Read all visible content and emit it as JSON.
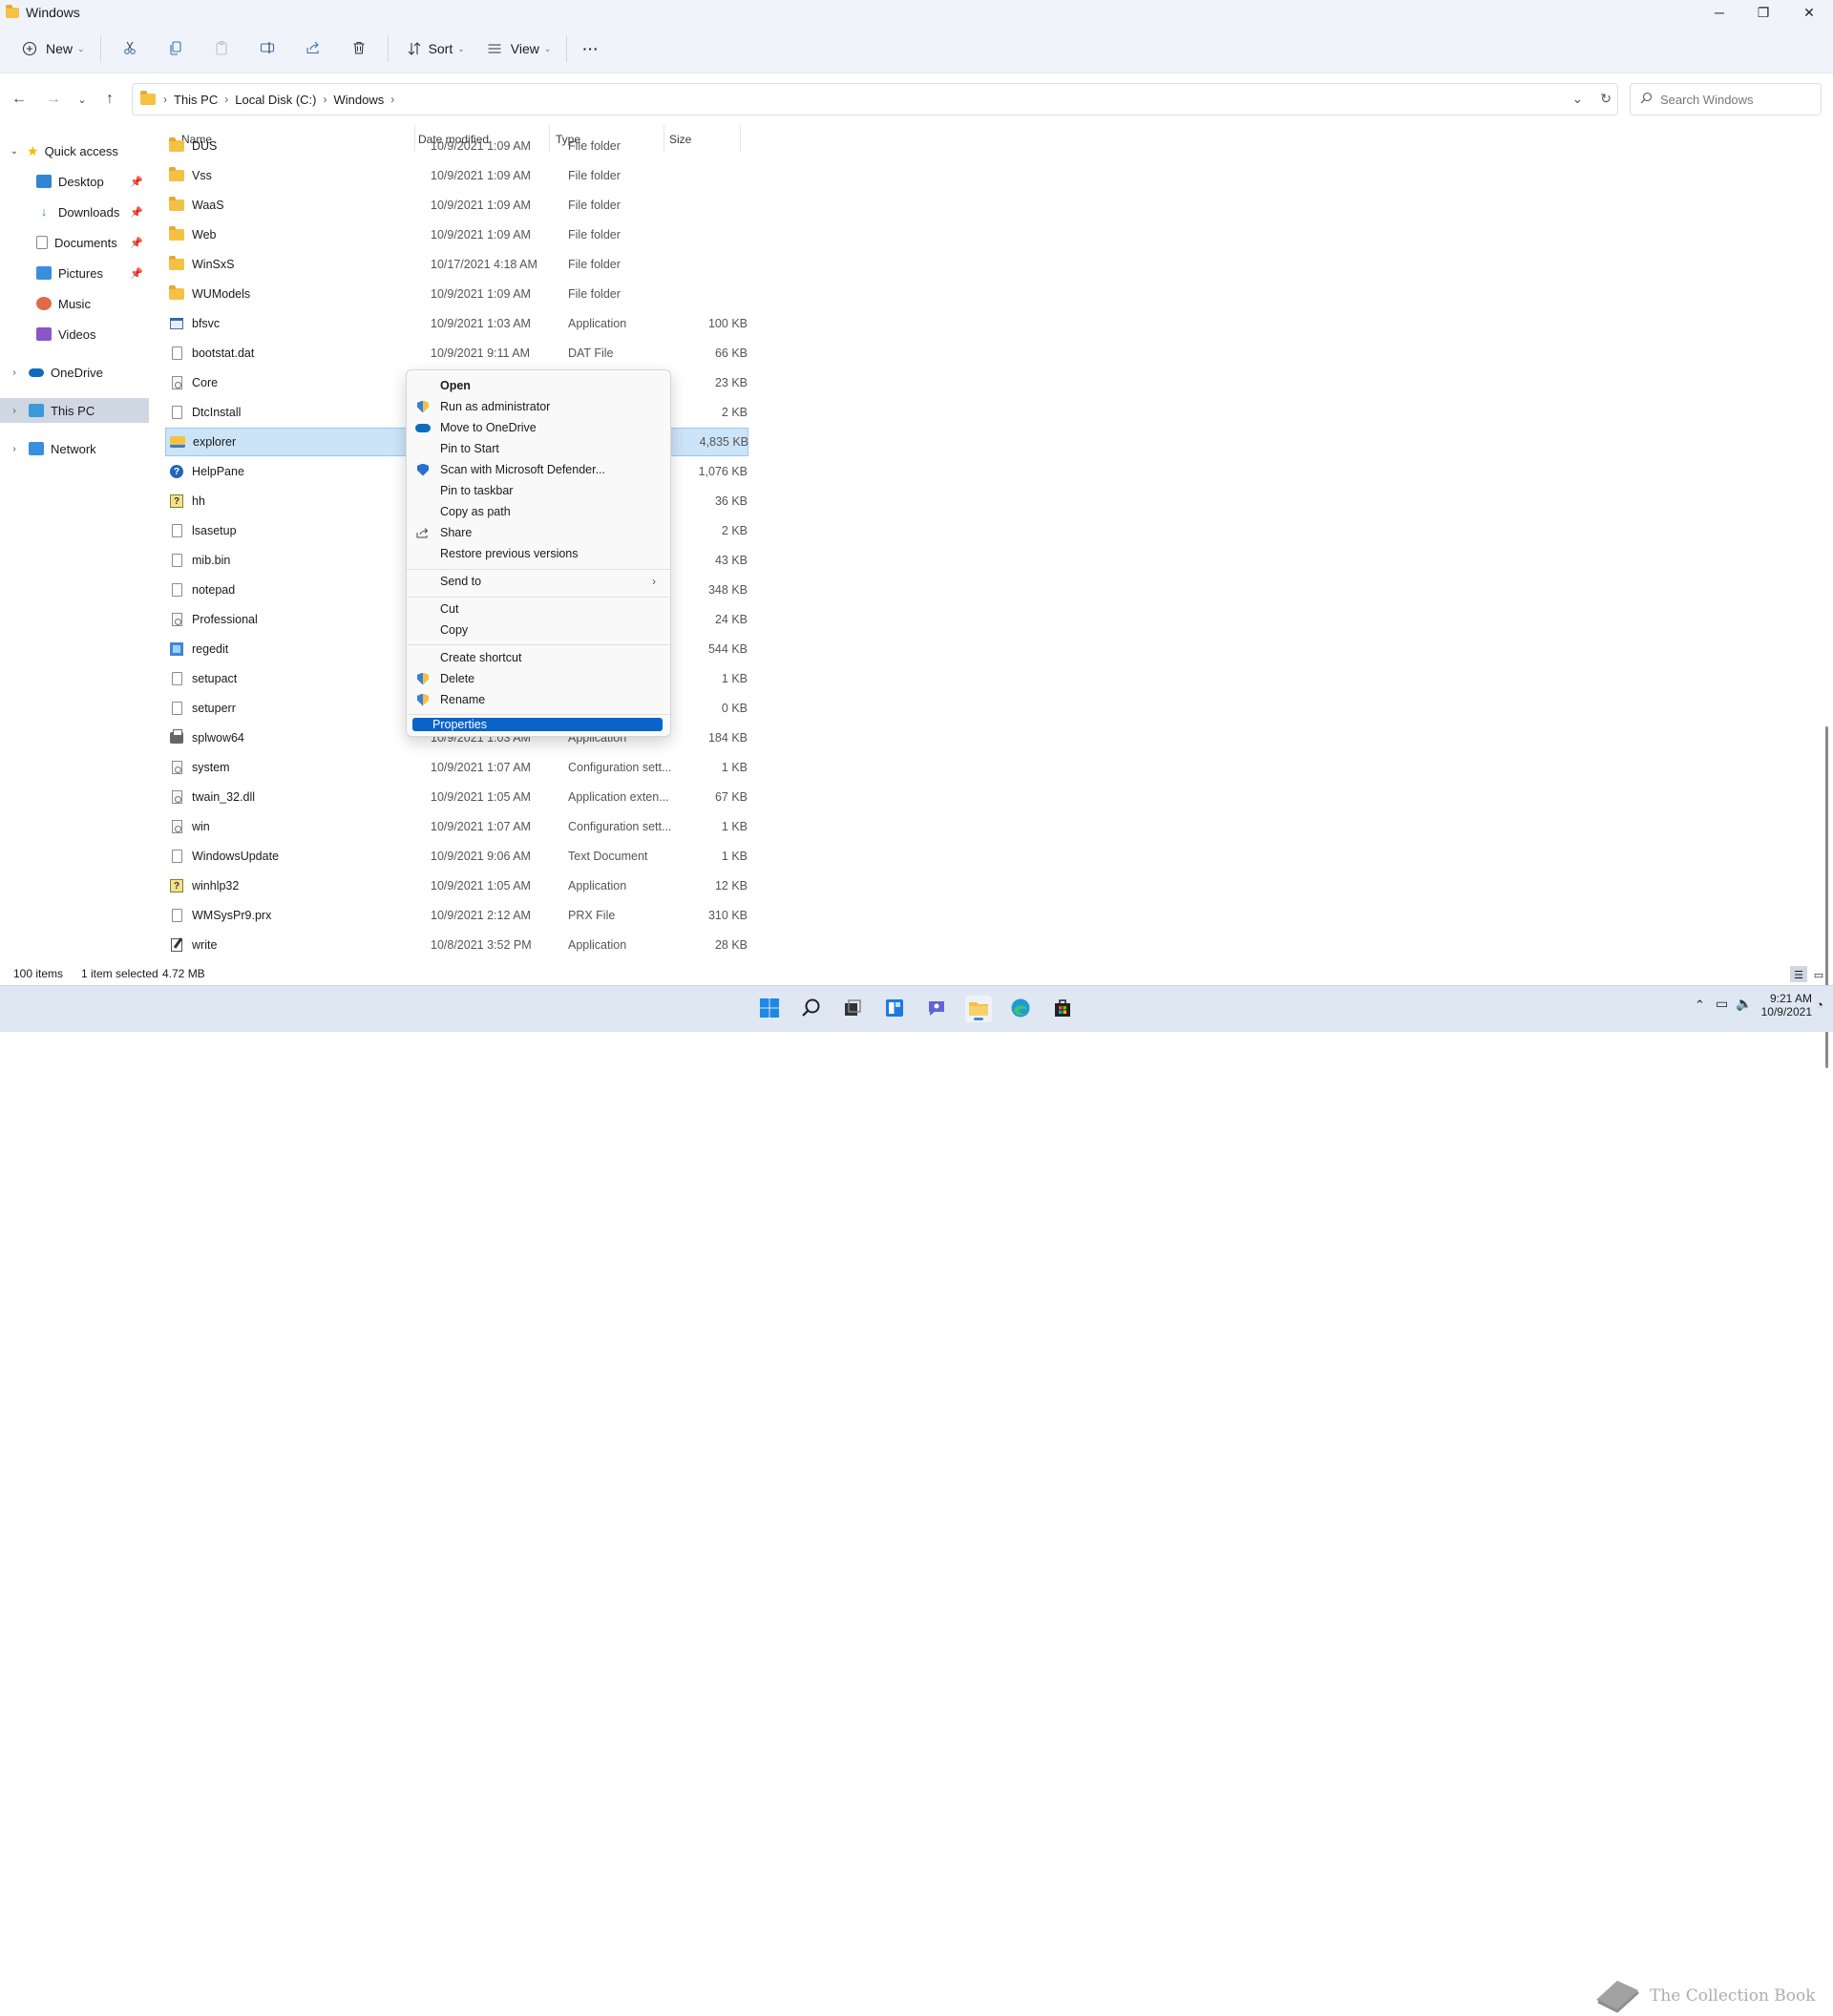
{
  "window": {
    "title": "Windows",
    "minimize": "─",
    "maximize": "❐",
    "close": "✕"
  },
  "toolbar": {
    "new_label": "New",
    "sort_label": "Sort",
    "view_label": "View",
    "more_label": "···"
  },
  "address": {
    "crumbs": [
      "This PC",
      "Local Disk (C:)",
      "Windows"
    ],
    "search_placeholder": "Search Windows"
  },
  "nav": {
    "quick_access": "Quick access",
    "items": [
      {
        "label": "Desktop",
        "color": "#2f86d4"
      },
      {
        "label": "Downloads",
        "color": "#2aa44f"
      },
      {
        "label": "Documents",
        "color": "#8a8a8a"
      },
      {
        "label": "Pictures",
        "color": "#3a8ee0"
      },
      {
        "label": "Music",
        "color": "#e06a4a"
      },
      {
        "label": "Videos",
        "color": "#8a56c8"
      }
    ],
    "onedrive": "OneDrive",
    "this_pc": "This PC",
    "network": "Network"
  },
  "columns": {
    "name": "Name",
    "date": "Date modified",
    "type": "Type",
    "size": "Size"
  },
  "files": [
    {
      "name": "DUS",
      "date": "10/9/2021 1:09 AM",
      "type": "File folder",
      "size": "",
      "icon": "folder"
    },
    {
      "name": "Vss",
      "date": "10/9/2021 1:09 AM",
      "type": "File folder",
      "size": "",
      "icon": "folder"
    },
    {
      "name": "WaaS",
      "date": "10/9/2021 1:09 AM",
      "type": "File folder",
      "size": "",
      "icon": "folder"
    },
    {
      "name": "Web",
      "date": "10/9/2021 1:09 AM",
      "type": "File folder",
      "size": "",
      "icon": "folder"
    },
    {
      "name": "WinSxS",
      "date": "10/17/2021 4:18 AM",
      "type": "File folder",
      "size": "",
      "icon": "folder"
    },
    {
      "name": "WUModels",
      "date": "10/9/2021 1:09 AM",
      "type": "File folder",
      "size": "",
      "icon": "folder"
    },
    {
      "name": "bfsvc",
      "date": "10/9/2021 1:03 AM",
      "type": "Application",
      "size": "100 KB",
      "icon": "app"
    },
    {
      "name": "bootstat.dat",
      "date": "10/9/2021 9:11 AM",
      "type": "DAT File",
      "size": "66 KB",
      "icon": "file"
    },
    {
      "name": "Core",
      "date": "",
      "type": "",
      "size": "23 KB",
      "icon": "cfg"
    },
    {
      "name": "DtcInstall",
      "date": "",
      "type": "",
      "size": "2 KB",
      "icon": "file"
    },
    {
      "name": "explorer",
      "date": "",
      "type": "",
      "size": "4,835 KB",
      "icon": "explorer"
    },
    {
      "name": "HelpPane",
      "date": "",
      "type": "",
      "size": "1,076 KB",
      "icon": "help"
    },
    {
      "name": "hh",
      "date": "",
      "type": "",
      "size": "36 KB",
      "icon": "hh"
    },
    {
      "name": "lsasetup",
      "date": "",
      "type": "",
      "size": "2 KB",
      "icon": "file"
    },
    {
      "name": "mib.bin",
      "date": "",
      "type": "",
      "size": "43 KB",
      "icon": "file"
    },
    {
      "name": "notepad",
      "date": "",
      "type": "",
      "size": "348 KB",
      "icon": "file"
    },
    {
      "name": "Professional",
      "date": "",
      "type": "",
      "size": "24 KB",
      "icon": "cfg"
    },
    {
      "name": "regedit",
      "date": "",
      "type": "",
      "size": "544 KB",
      "icon": "reg"
    },
    {
      "name": "setupact",
      "date": "",
      "type": "",
      "size": "1 KB",
      "icon": "file"
    },
    {
      "name": "setuperr",
      "date": "",
      "type": "",
      "size": "0 KB",
      "icon": "file"
    },
    {
      "name": "splwow64",
      "date": "10/9/2021 1:03 AM",
      "type": "Application",
      "size": "184 KB",
      "icon": "print"
    },
    {
      "name": "system",
      "date": "10/9/2021 1:07 AM",
      "type": "Configuration sett...",
      "size": "1 KB",
      "icon": "cfg"
    },
    {
      "name": "twain_32.dll",
      "date": "10/9/2021 1:05 AM",
      "type": "Application exten...",
      "size": "67 KB",
      "icon": "cfg"
    },
    {
      "name": "win",
      "date": "10/9/2021 1:07 AM",
      "type": "Configuration sett...",
      "size": "1 KB",
      "icon": "cfg"
    },
    {
      "name": "WindowsUpdate",
      "date": "10/9/2021 9:06 AM",
      "type": "Text Document",
      "size": "1 KB",
      "icon": "file"
    },
    {
      "name": "winhlp32",
      "date": "10/9/2021 1:05 AM",
      "type": "Application",
      "size": "12 KB",
      "icon": "hh"
    },
    {
      "name": "WMSysPr9.prx",
      "date": "10/9/2021 2:12 AM",
      "type": "PRX File",
      "size": "310 KB",
      "icon": "file"
    },
    {
      "name": "write",
      "date": "10/8/2021 3:52 PM",
      "type": "Application",
      "size": "28 KB",
      "icon": "write"
    }
  ],
  "context_menu": {
    "open": "Open",
    "run_as_admin": "Run as administrator",
    "move_onedrive": "Move to OneDrive",
    "pin_start": "Pin to Start",
    "scan_defender": "Scan with Microsoft Defender...",
    "pin_taskbar": "Pin to taskbar",
    "copy_path": "Copy as path",
    "share": "Share",
    "restore": "Restore previous versions",
    "send_to": "Send to",
    "cut": "Cut",
    "copy": "Copy",
    "create_shortcut": "Create shortcut",
    "delete": "Delete",
    "rename": "Rename",
    "properties": "Properties"
  },
  "status": {
    "item_count": "100 items",
    "selected": "1 item selected",
    "size": "4.72 MB"
  },
  "taskbar": {
    "time": "9:21 AM",
    "date": "10/9/2021",
    "watermark": "The Collection Book"
  }
}
